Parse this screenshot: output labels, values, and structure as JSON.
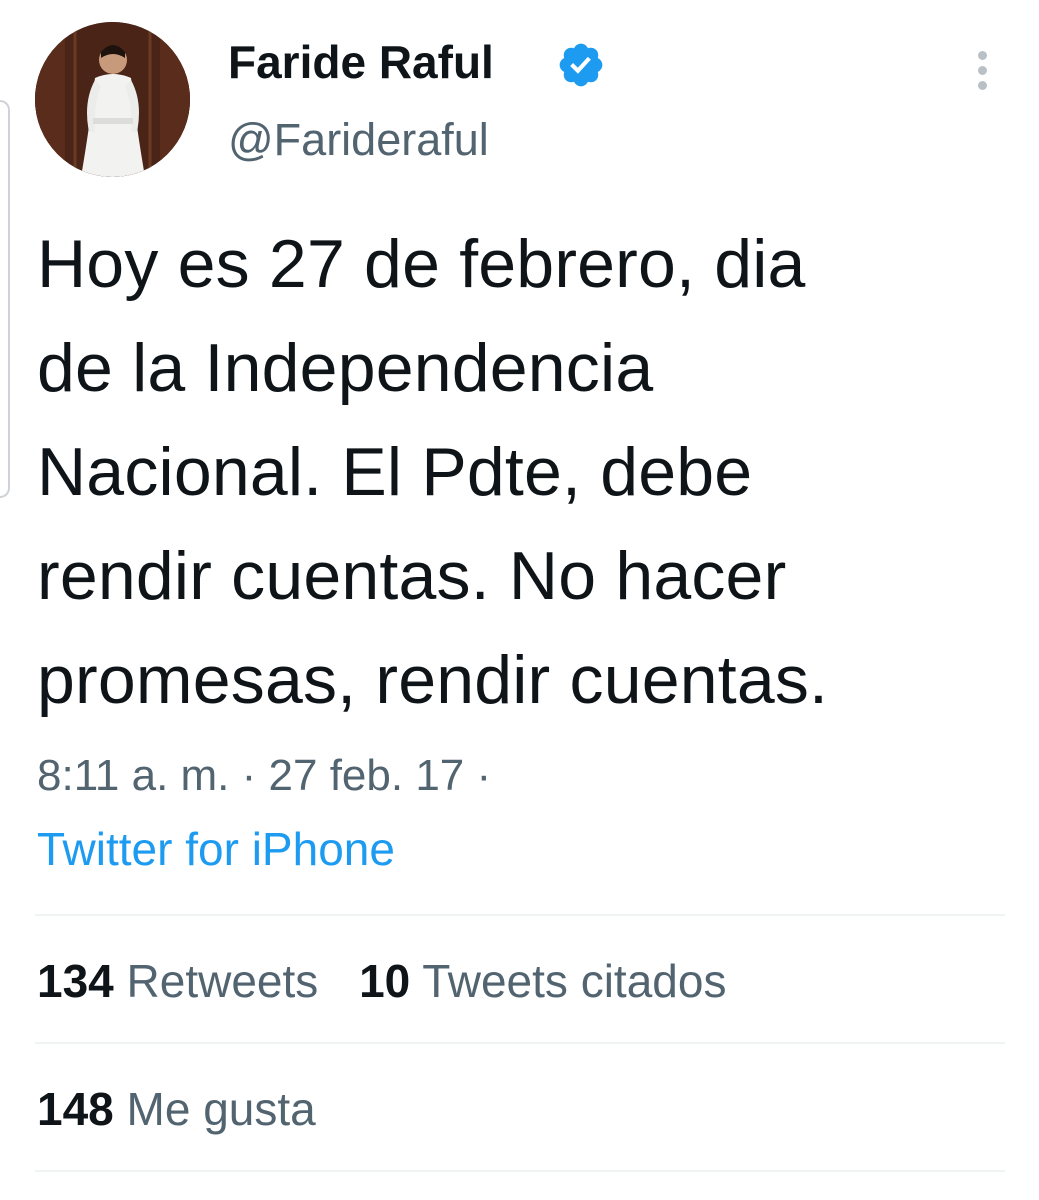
{
  "author": {
    "name": "Faride Raful",
    "handle": "@Farideraful",
    "verified": true,
    "avatar_icon": "profile-photo"
  },
  "colors": {
    "verified_badge": "#1d9bf0",
    "link": "#1d9bf0",
    "secondary_text": "#536471",
    "primary_text": "#0f1419",
    "divider": "#eff3f4"
  },
  "tweet": {
    "lines": [
      "Hoy es 27 de febrero, dia",
      "de la Independencia",
      "Nacional. El Pdte, debe",
      "rendir cuentas. No hacer",
      "promesas, rendir cuentas."
    ],
    "time": "8:11 a. m.",
    "date": "27 feb. 17",
    "separator": "·",
    "source": "Twitter for iPhone"
  },
  "stats": {
    "retweets": {
      "count": "134",
      "label": "Retweets"
    },
    "quotes": {
      "count": "10",
      "label": "Tweets citados"
    },
    "likes": {
      "count": "148",
      "label": "Me gusta"
    }
  },
  "icons": {
    "verified": "verified-badge-icon",
    "more": "more-options-icon"
  }
}
